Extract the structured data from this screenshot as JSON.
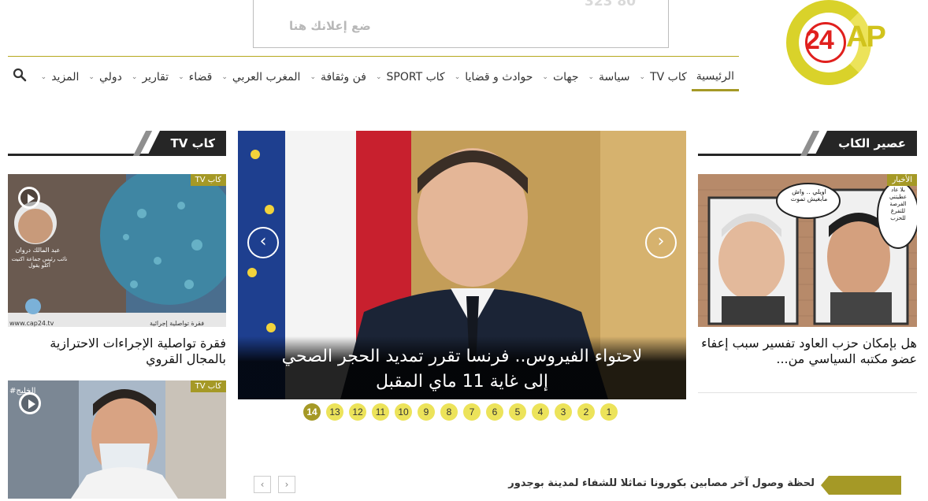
{
  "ad": {
    "top_text": "323 80",
    "label": "ضع إعلانك هنا"
  },
  "logo": {
    "number": "24",
    "letters": "AP"
  },
  "nav": {
    "items": [
      {
        "label": "الرئيسية",
        "caret": false,
        "active": true
      },
      {
        "label": "كاب TV",
        "caret": true
      },
      {
        "label": "سياسة",
        "caret": true
      },
      {
        "label": "جهات",
        "caret": true
      },
      {
        "label": "حوادث و قضايا",
        "caret": true
      },
      {
        "label": "كاب SPORT",
        "caret": true
      },
      {
        "label": "فن وثقافة",
        "caret": true
      },
      {
        "label": "المغرب العربي",
        "caret": true
      },
      {
        "label": "قضاء",
        "caret": true
      },
      {
        "label": "تقارير",
        "caret": true
      },
      {
        "label": "دولي",
        "caret": true
      },
      {
        "label": "المزيد",
        "caret": true
      }
    ],
    "caret_glyph": "⌄"
  },
  "right_section": {
    "title": "عصير الكاب",
    "card": {
      "badge": "الأخبار",
      "bubble_left": "اويلي .. واش مابغيش تموت",
      "bubble_right": "بلا عاد عطيتني الفرصة للتفرغ للحزب",
      "title": "هل بإمكان حزب العاود تفسير سبب إعفاء عضو مكتبه السياسي من..."
    }
  },
  "left_section": {
    "title": "كاب TV",
    "cards": [
      {
        "badge": "كاب TV",
        "name": "عبد المالك دروان",
        "subtitle": "نائب رئيس جماعة اكنيت أكلو يقول",
        "site": "www.cap24.tv",
        "bottom": "فقرة تواصلية إجرائية",
        "title": "فقرة تواصلية الإجراءات الاحترازية بالمجال القروي"
      },
      {
        "badge": "كاب TV",
        "corner": "الخليج#"
      }
    ]
  },
  "slider": {
    "caption": "لاحتواء الفيروس.. فرنسا تقرر تمديد الحجر الصحي إلى غاية 11 ماي المقبل",
    "prev": "‹",
    "next": "›",
    "pages": [
      "14",
      "13",
      "12",
      "11",
      "10",
      "9",
      "8",
      "7",
      "6",
      "5",
      "4",
      "3",
      "2",
      "1"
    ],
    "active_page": "14"
  },
  "ticker": {
    "text": "لحظة وصول آخر مصابين بكورونا تماثلا للشفاء لمدينة بوجدور",
    "prev": "‹",
    "next": "›"
  },
  "colors": {
    "accent": "#a59926",
    "logo_yellow": "#d9d22a",
    "logo_red": "#e0201e",
    "dark": "#262626"
  }
}
